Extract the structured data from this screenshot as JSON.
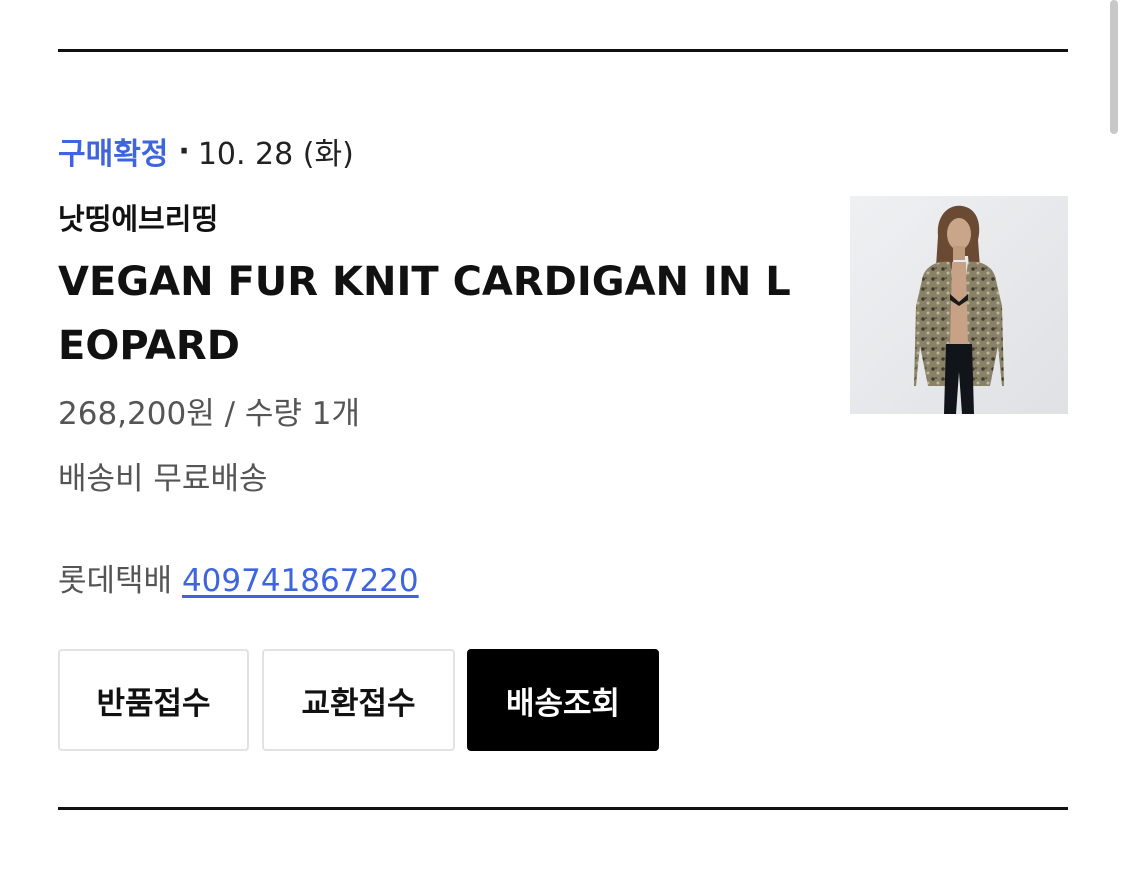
{
  "order": {
    "status": "구매확정",
    "separator": "·",
    "date": "10. 28 (화)",
    "brand": "낫띵에브리띵",
    "product_name": "VEGAN FUR KNIT CARDIGAN IN LEOPARD",
    "price_qty": "268,200원 / 수량 1개",
    "shipping_fee": "배송비 무료배송",
    "courier": "롯데택배",
    "tracking_number": "409741867220",
    "image_alt": "product-photo"
  },
  "actions": {
    "return_label": "반품접수",
    "exchange_label": "교환접수",
    "track_label": "배송조회"
  },
  "colors": {
    "status_accent": "#3e64e0",
    "link": "#3e64e0",
    "primary_button": "#000000",
    "secondary_text": "#555555"
  }
}
